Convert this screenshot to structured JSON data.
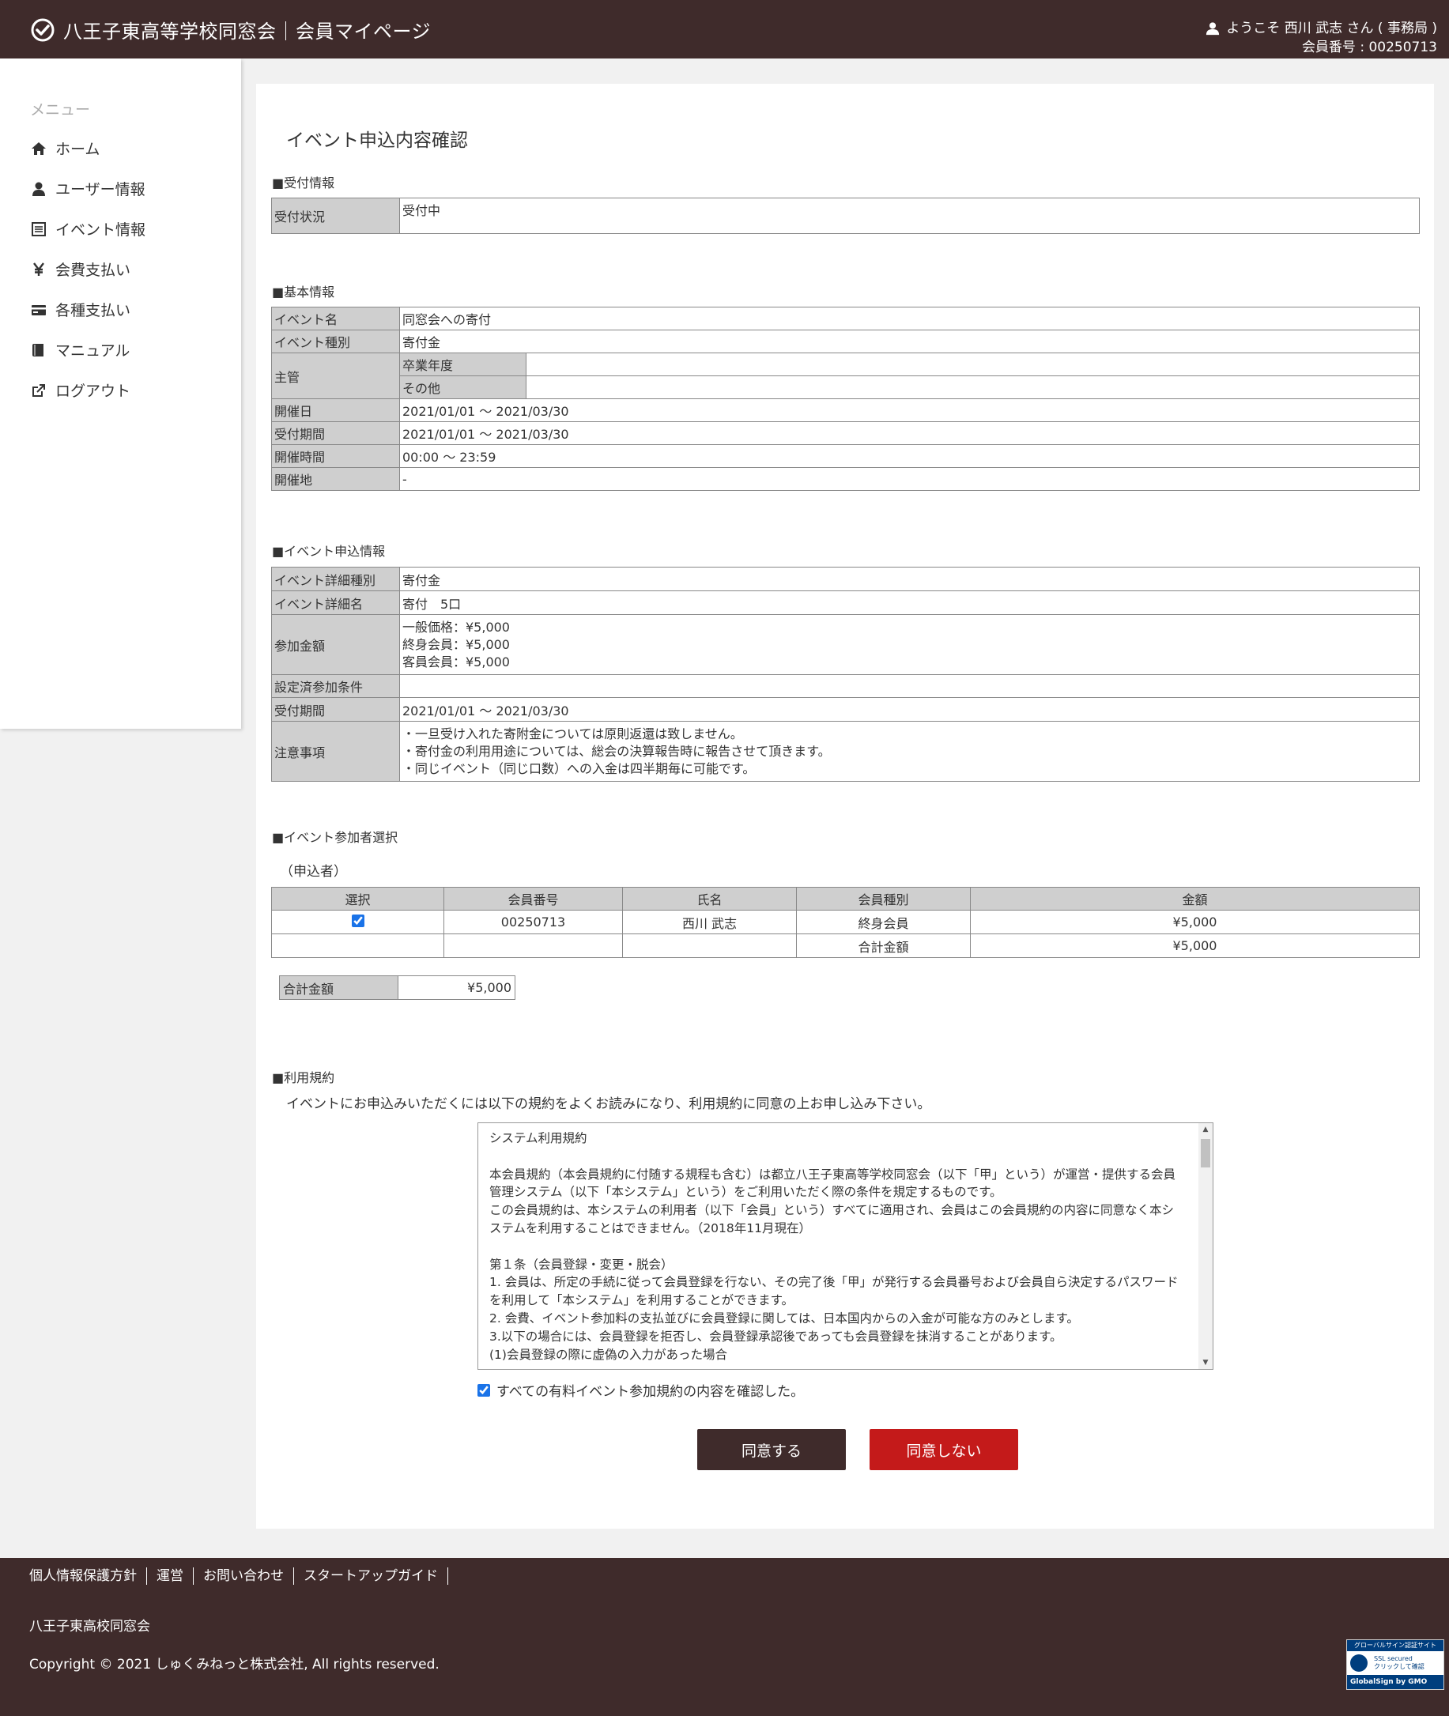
{
  "header": {
    "title": "八王子東高等学校同窓会｜会員マイページ",
    "welcome": "ようこそ 西川 武志 さん ( 事務局 )",
    "member_no": "会員番号 : 00250713"
  },
  "sidebar": {
    "title": "メニュー",
    "items": [
      {
        "label": "ホーム",
        "icon": "home-icon"
      },
      {
        "label": "ユーザー情報",
        "icon": "user-icon"
      },
      {
        "label": "イベント情報",
        "icon": "list-icon"
      },
      {
        "label": "会費支払い",
        "icon": "yen-icon"
      },
      {
        "label": "各種支払い",
        "icon": "card-icon"
      },
      {
        "label": "マニュアル",
        "icon": "book-icon"
      },
      {
        "label": "ログアウト",
        "icon": "logout-icon"
      }
    ]
  },
  "main": {
    "title": "イベント申込内容確認",
    "reception": {
      "section": "■受付情報",
      "status_label": "受付状況",
      "status_value": "受付中"
    },
    "basic": {
      "section": "■基本情報",
      "event_name_label": "イベント名",
      "event_name": "同窓会への寄付",
      "event_type_label": "イベント種別",
      "event_type": "寄付金",
      "host_label": "主管",
      "grad_year_label": "卒業年度",
      "grad_year": "",
      "other_label": "その他",
      "other": "",
      "date_label": "開催日",
      "date": "2021/01/01 ～ 2021/03/30",
      "accept_label": "受付期間",
      "accept": "2021/01/01 ～ 2021/03/30",
      "time_label": "開催時間",
      "time": "00:00 ～ 23:59",
      "place_label": "開催地",
      "place": "-"
    },
    "application": {
      "section": "■イベント申込情報",
      "detail_type_label": "イベント詳細種別",
      "detail_type": "寄付金",
      "detail_name_label": "イベント詳細名",
      "detail_name": "寄付　5口",
      "fee_label": "参加金額",
      "fees": [
        "一般価格：¥5,000",
        "終身会員：¥5,000",
        "客員会員：¥5,000"
      ],
      "conditions_label": "設定済参加条件",
      "conditions": "",
      "accept_label": "受付期間",
      "accept": "2021/01/01 ～ 2021/03/30",
      "notes_label": "注意事項",
      "notes": [
        "・一旦受け入れた寄附金については原則返還は致しません。",
        "・寄付金の利用用途については、総会の決算報告時に報告させて頂きます。",
        "・同じイベント（同じ口数）への入金は四半期毎に可能です。"
      ]
    },
    "participants": {
      "section": "■イベント参加者選択",
      "applicant_label": "（申込者）",
      "columns": [
        "選択",
        "会員番号",
        "氏名",
        "会員種別",
        "金額"
      ],
      "row": {
        "member_no": "00250713",
        "name": "西川 武志",
        "type": "終身会員",
        "amount": "¥5,000",
        "checked": true
      },
      "subtotal_label": "合計金額",
      "subtotal": "¥5,000"
    },
    "total": {
      "label": "合計金額",
      "value": "¥5,000"
    },
    "terms": {
      "section": "■利用規約",
      "intro": "イベントにお申込みいただくには以下の規約をよくお読みになり、利用規約に同意の上お申し込み下さい。",
      "text": "システム利用規約\n\n本会員規約（本会員規約に付随する規程も含む）は都立八王子東高等学校同窓会（以下「甲」という）が運営・提供する会員管理システム（以下「本システム」という）をご利用いただく際の条件を規定するものです。\nこの会員規約は、本システムの利用者（以下「会員」という）すべてに適用され、会員はこの会員規約の内容に同意なく本システムを利用することはできません。（2018年11月現在）\n\n第１条（会員登録・変更・脱会）\n1. 会員は、所定の手続に従って会員登録を行ない、その完了後「甲」が発行する会員番号および会員自ら決定するパスワードを利用して「本システム」を利用することができます。\n2. 会費、イベント参加料の支払並びに会員登録に関しては、日本国内からの入金が可能な方のみとします。\n3.以下の場合には、会員登録を拒否し、会員登録承認後であっても会員登録を抹消することがあります。\n(1)会員登録の際に虚偽の入力があった場合",
      "agree_label": "すべての有料イベント参加規約の内容を確認した。",
      "agree_checked": true
    },
    "buttons": {
      "agree": "同意する",
      "disagree": "同意しない"
    }
  },
  "footer": {
    "links": [
      "個人情報保護方針",
      "運営",
      "お問い合わせ",
      "スタートアップガイド"
    ],
    "org": "八王子東高校同窓会",
    "copyright": "Copyright © 2021 しゅくみねっと株式会社, All rights reserved.",
    "badge_top": "グローバルサイン認証サイト",
    "badge_ssl": "SSL secured",
    "badge_click": "クリックして確認",
    "badge_brand": "GlobalSign by GMO"
  },
  "colors": {
    "header_bg": "#3f2b2b",
    "label_bg": "#cfcfcf",
    "agree_btn": "#3f2b2b",
    "disagree_btn": "#c41a1a",
    "check": "#1a73e8"
  }
}
